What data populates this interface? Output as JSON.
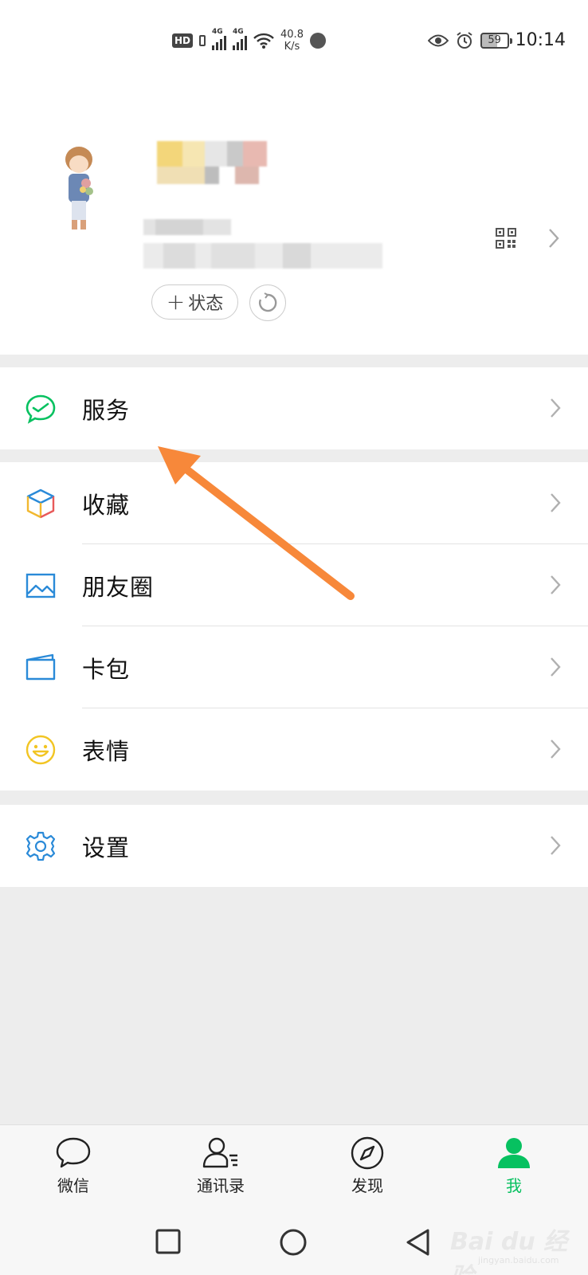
{
  "status_bar": {
    "hd": "HD",
    "net1": "4G",
    "net2": "4G",
    "speed_value": "40.8",
    "speed_unit": "K/s",
    "battery": "59",
    "time": "10:14"
  },
  "profile": {
    "status_button_label": "状态"
  },
  "menu": {
    "services": "服务",
    "favorites": "收藏",
    "moments": "朋友圈",
    "cards": "卡包",
    "stickers": "表情",
    "settings": "设置"
  },
  "tabs": {
    "chats": "微信",
    "contacts": "通讯录",
    "discover": "发现",
    "me": "我"
  },
  "watermark": {
    "logo": "Bai du 经验",
    "site": "jingyan.baidu.com"
  },
  "colors": {
    "accent_green": "#07c160",
    "arrow_orange": "#f7883a",
    "background": "#ededed"
  }
}
